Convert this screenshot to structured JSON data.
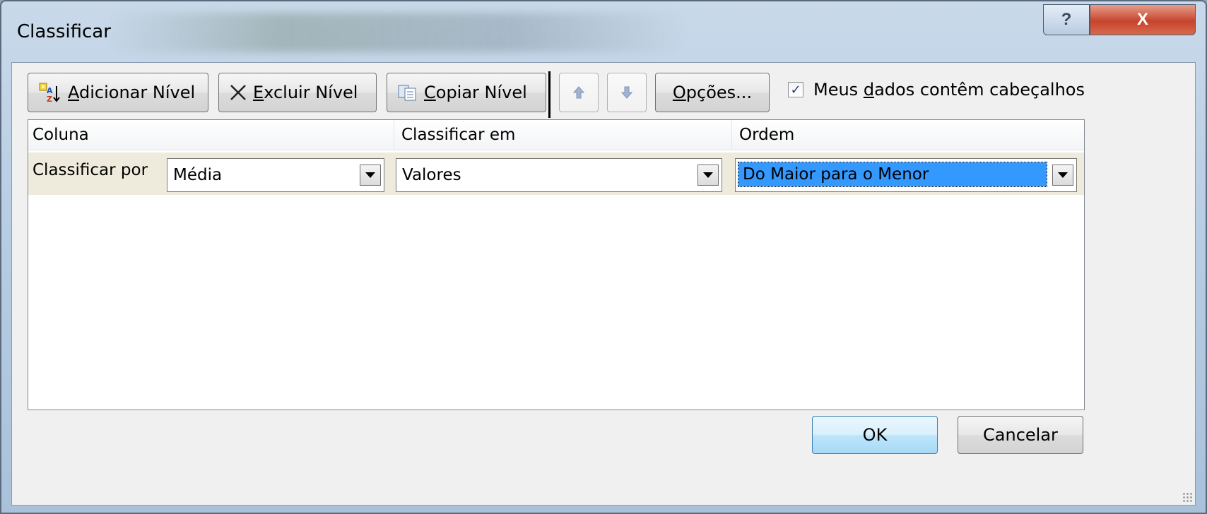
{
  "window": {
    "title": "Classificar",
    "help_glyph": "?",
    "close_glyph": "X"
  },
  "toolbar": {
    "add_level_pre": "",
    "add_level_ul": "A",
    "add_level_post": "dicionar Nível",
    "delete_level_pre": "",
    "delete_level_ul": "E",
    "delete_level_post": "xcluir Nível",
    "copy_level_pre": "",
    "copy_level_ul": "C",
    "copy_level_post": "opiar Nível",
    "options_pre": "",
    "options_ul": "O",
    "options_post": "pções...",
    "headers_checkbox": {
      "checked": true,
      "label_pre": "Meus ",
      "label_ul": "d",
      "label_post": "ados contêm cabeçalhos"
    }
  },
  "grid": {
    "headers": [
      "Coluna",
      "Classificar em",
      "Ordem"
    ],
    "rows": [
      {
        "label": "Classificar por",
        "column": "Média",
        "sort_on": "Valores",
        "order": "Do Maior para o Menor"
      }
    ]
  },
  "footer": {
    "ok_label": "OK",
    "cancel_label": "Cancelar"
  },
  "icons": {
    "add": "sort-add-icon",
    "delete": "x-icon",
    "copy": "copy-icon",
    "up": "arrow-up-icon",
    "down": "arrow-down-icon",
    "dropdown": "chevron-down-icon"
  }
}
